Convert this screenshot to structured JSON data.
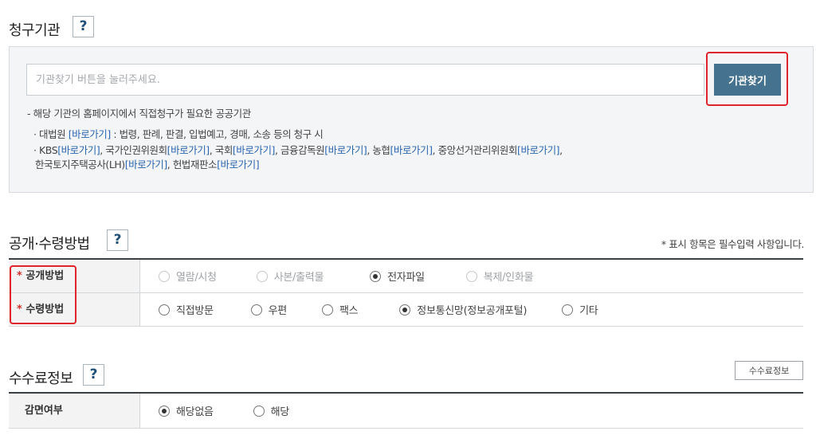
{
  "agency_section": {
    "title": "청구기관",
    "help": "?",
    "search_placeholder": "기관찾기 버튼을 눌러주세요.",
    "search_button": "기관찾기",
    "note": "- 해당 기관의 홈페이지에서 직접청구가 필요한 공공기관",
    "line1": {
      "pre": "· 대법원 ",
      "link": "[바로가기]",
      "post": " : 법령, 판례, 판결, 입법예고, 경매, 소송 등의 청구 시"
    },
    "line2": [
      {
        "name": "· KBS",
        "link": "[바로가기]"
      },
      {
        "name": ", 국가인권위원회",
        "link": "[바로가기]"
      },
      {
        "name": ", 국회",
        "link": "[바로가기]"
      },
      {
        "name": ", 금융감독원",
        "link": "[바로가기]"
      },
      {
        "name": ", 농협",
        "link": "[바로가기]"
      },
      {
        "name": ", 중앙선거관리위원회",
        "link": "[바로가기]"
      },
      {
        "name": ",",
        "link": ""
      }
    ],
    "line3": [
      {
        "name": "한국토지주택공사(LH)",
        "link": "[바로가기]"
      },
      {
        "name": ", 헌법재판소",
        "link": "[바로가기]"
      }
    ]
  },
  "method_section": {
    "title": "공개·수령방법",
    "help": "?",
    "required_note": "* 표시 항목은 필수입력 사항입니다.",
    "disclosure": {
      "label": "공개방법",
      "options": [
        {
          "label": "열람/시청",
          "selected": false,
          "disabled": true
        },
        {
          "label": "사본/출력물",
          "selected": false,
          "disabled": true
        },
        {
          "label": "전자파일",
          "selected": true,
          "disabled": false
        },
        {
          "label": "복제/인화물",
          "selected": false,
          "disabled": true
        }
      ]
    },
    "receipt": {
      "label": "수령방법",
      "options": [
        {
          "label": "직접방문",
          "selected": false
        },
        {
          "label": "우편",
          "selected": false
        },
        {
          "label": "팩스",
          "selected": false
        },
        {
          "label": "정보통신망(정보공개포털)",
          "selected": true
        },
        {
          "label": "기타",
          "selected": false
        }
      ]
    }
  },
  "fee_section": {
    "title": "수수료정보",
    "help": "?",
    "fee_button": "수수료정보",
    "reduction": {
      "label": "감면여부",
      "options": [
        {
          "label": "해당없음",
          "selected": true
        },
        {
          "label": "해당",
          "selected": false
        }
      ]
    }
  },
  "colors": {
    "accent": "#44728f",
    "highlight": "#e0242b",
    "link": "#2a66b0",
    "required": "#d0312d"
  }
}
